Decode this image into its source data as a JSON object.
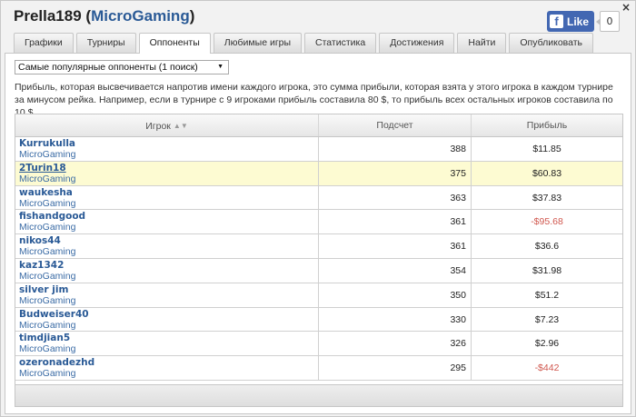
{
  "header": {
    "player": "Prella189",
    "open_paren": " (",
    "network": "MicroGaming",
    "close_paren": ")"
  },
  "close_label": "×",
  "facebook": {
    "like_label": "Like",
    "f_glyph": "f",
    "count": "0",
    "brand_color": "#4267b2"
  },
  "tabs": [
    {
      "label": "Графики",
      "active": false
    },
    {
      "label": "Турниры",
      "active": false
    },
    {
      "label": "Оппоненты",
      "active": true
    },
    {
      "label": "Любимые игры",
      "active": false
    },
    {
      "label": "Статистика",
      "active": false
    },
    {
      "label": "Достижения",
      "active": false
    },
    {
      "label": "Найти",
      "active": false
    },
    {
      "label": "Опубликовать",
      "active": false
    }
  ],
  "filter": {
    "selected": "Самые популярные оппоненты (1 поиск)",
    "arrow": "▼"
  },
  "description": "Прибыль, которая высвечивается напротив имени каждого игрока, это сумма прибыли, которая взята у этого игрока в каждом турнире за минусом рейка. Например, если в турнире с 9 игроками прибыль составила 80 $, то прибыль всех остальных игроков составила по 10 $.",
  "table": {
    "columns": [
      {
        "label": "Игрок",
        "sortable": true
      },
      {
        "label": "Подсчет"
      },
      {
        "label": "Прибыль"
      }
    ],
    "sort_icon": "▲▼",
    "rows": [
      {
        "name": "Kurrukulla",
        "network": "MicroGaming",
        "count": "388",
        "profit": "$11.85",
        "negative": false,
        "highlight": false
      },
      {
        "name": "2Turin18",
        "network": "MicroGaming",
        "count": "375",
        "profit": "$60.83",
        "negative": false,
        "highlight": true
      },
      {
        "name": "waukesha",
        "network": "MicroGaming",
        "count": "363",
        "profit": "$37.83",
        "negative": false,
        "highlight": false
      },
      {
        "name": "fishandgood",
        "network": "MicroGaming",
        "count": "361",
        "profit": "-$95.68",
        "negative": true,
        "highlight": false
      },
      {
        "name": "nikos44",
        "network": "MicroGaming",
        "count": "361",
        "profit": "$36.6",
        "negative": false,
        "highlight": false
      },
      {
        "name": "kaz1342",
        "network": "MicroGaming",
        "count": "354",
        "profit": "$31.98",
        "negative": false,
        "highlight": false
      },
      {
        "name": "silver jim",
        "network": "MicroGaming",
        "count": "350",
        "profit": "$51.2",
        "negative": false,
        "highlight": false
      },
      {
        "name": "Budweiser40",
        "network": "MicroGaming",
        "count": "330",
        "profit": "$7.23",
        "negative": false,
        "highlight": false
      },
      {
        "name": "timdjian5",
        "network": "MicroGaming",
        "count": "326",
        "profit": "$2.96",
        "negative": false,
        "highlight": false
      },
      {
        "name": "ozeronadezhd",
        "network": "MicroGaming",
        "count": "295",
        "profit": "-$442",
        "negative": true,
        "highlight": false
      }
    ]
  },
  "colors": {
    "link": "#2a5a96",
    "negative": "#d0574e",
    "highlight_row": "#fdfbd2"
  }
}
